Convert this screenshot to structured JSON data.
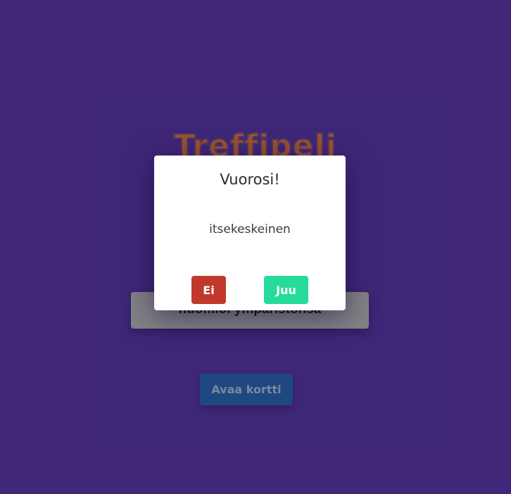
{
  "game": {
    "title": "Treffipeli",
    "card_text": "huomioi ympäristönsä",
    "open_card_label": "Avaa kortti"
  },
  "modal": {
    "title": "Vuorosi!",
    "word": "itsekeskeinen",
    "no_label": "Ei",
    "yes_label": "Juu"
  },
  "colors": {
    "background": "#42297c",
    "title": "#a75a2b",
    "card": "#8a8a8a",
    "open_card_button": "#1f4d86",
    "no_button": "#c0392b",
    "yes_button": "#25dc9b"
  }
}
